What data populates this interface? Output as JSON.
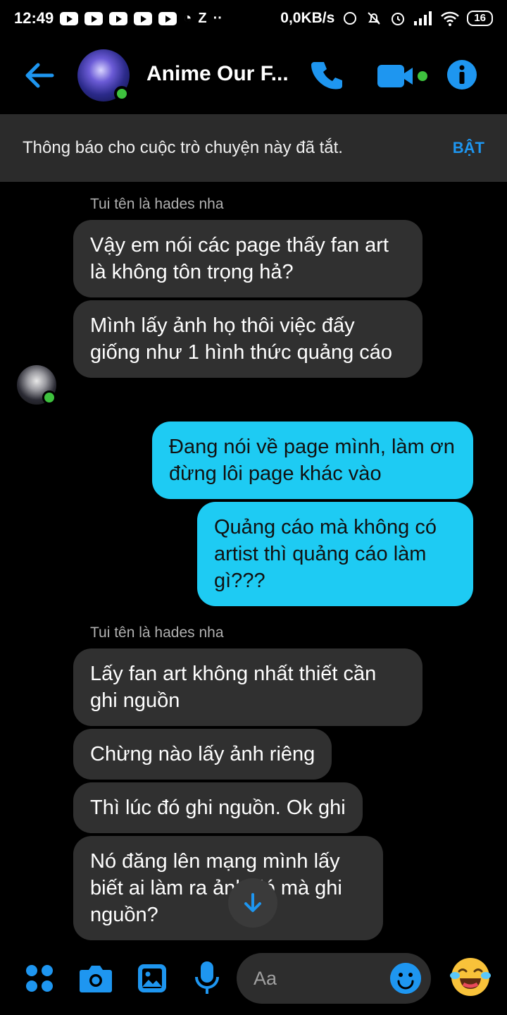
{
  "status_bar": {
    "time": "12:49",
    "netspeed": "0,0KB/s",
    "battery": "16"
  },
  "header": {
    "title": "Anime Our F...",
    "icons": [
      "back-arrow-icon",
      "phone-icon",
      "video-icon",
      "info-icon"
    ],
    "accent_color": "#1e96f0"
  },
  "banner": {
    "text": "Thông báo cho cuộc trò chuyện này đã tắt.",
    "button": "BẬT"
  },
  "messages": [
    {
      "sender": "Tui tên là hades nha"
    },
    {
      "direction": "in",
      "text": "Vậy em nói các page thấy fan art là không tôn trọng hả?"
    },
    {
      "direction": "in",
      "text": "Mình lấy ảnh họ thôi việc đấy giống như 1 hình thức quảng cáo"
    },
    {
      "direction": "out",
      "text": "Đang nói về page mình, làm ơn đừng lôi page khác vào"
    },
    {
      "direction": "out",
      "text": "Quảng cáo mà không có artist thì quảng cáo làm gì???"
    },
    {
      "sender": "Tui tên là hades nha"
    },
    {
      "direction": "in",
      "text": "Lấy fan art không nhất thiết cần ghi nguồn"
    },
    {
      "direction": "in",
      "text": "Chừng nào lấy ảnh riêng"
    },
    {
      "direction": "in",
      "text": "Thì lúc đó ghi nguồn. Ok ghi"
    },
    {
      "direction": "in",
      "text": "Nó đăng lên mạng mình lấy biết ai làm ra ảnh đó mà ghi nguồn?"
    }
  ],
  "composer": {
    "placeholder": "Aa",
    "icons": [
      "menu-dots-icon",
      "camera-icon",
      "gallery-icon",
      "microphone-icon",
      "emoji-icon",
      "laughing-emoji-icon"
    ]
  }
}
